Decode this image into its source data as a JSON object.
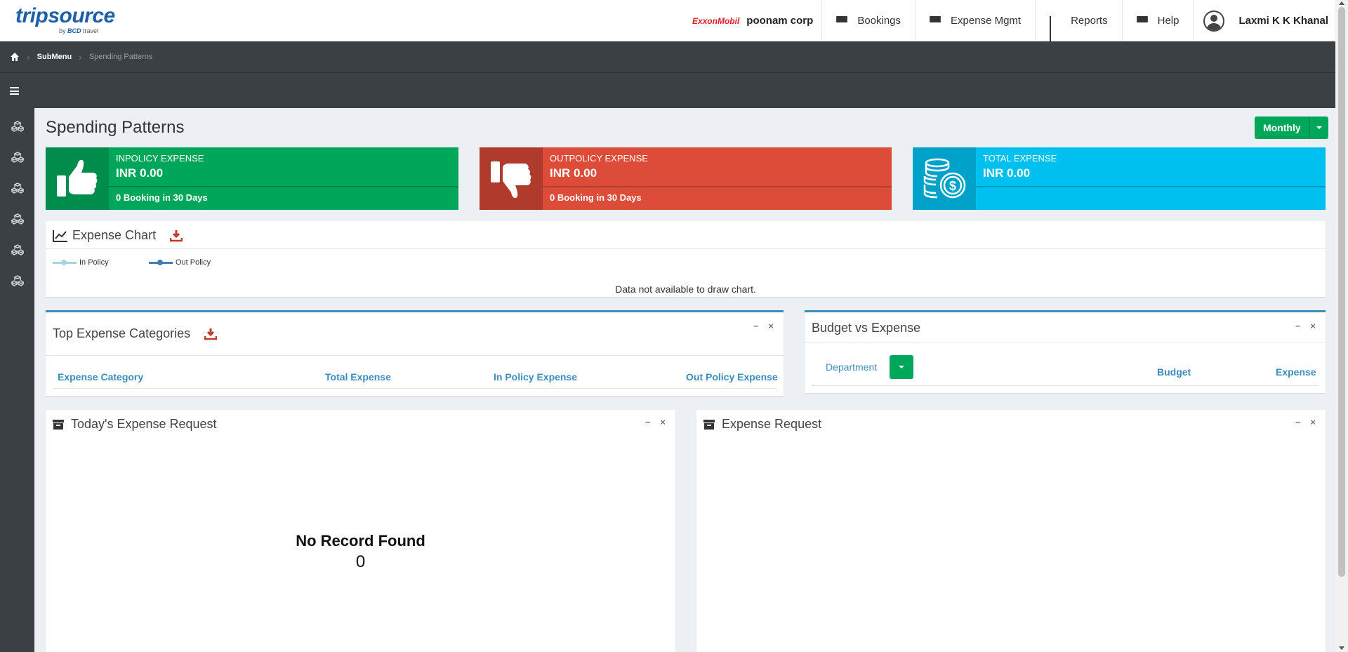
{
  "header": {
    "logo_trip": "trip",
    "logo_source": "source",
    "logo_by": "by",
    "logo_bcd": "BCD",
    "logo_travel": "travel",
    "company_logo": "ExxonMobil",
    "company_name": "poonam corp",
    "nav": [
      {
        "label": "Bookings",
        "icon": "hamburger-icon"
      },
      {
        "label": "Expense Mgmt",
        "icon": "hamburger-icon"
      },
      {
        "label": "Reports",
        "icon": "bar-chart-icon"
      },
      {
        "label": "Help",
        "icon": "hamburger-icon"
      }
    ],
    "user_name": "Laxmi K K Khanal"
  },
  "breadcrumb": {
    "submenu": "SubMenu",
    "current": "Spending Patterns"
  },
  "page": {
    "title": "Spending Patterns",
    "period_button": "Monthly"
  },
  "infoboxes": [
    {
      "title": "INPOLICY EXPENSE",
      "amount": "INR 0.00",
      "footer": "0 Booking in 30 Days",
      "color": "#00a65a",
      "icon_bg": "#008d4c",
      "icon": "thumbs-up-icon"
    },
    {
      "title": "OUTPOLICY EXPENSE",
      "amount": "INR 0.00",
      "footer": "0 Booking in 30 Days",
      "color": "#dd4b39",
      "icon_bg": "#b03a2c",
      "icon": "thumbs-down-icon"
    },
    {
      "title": "TOTAL EXPENSE",
      "amount": "INR 0.00",
      "footer": "",
      "color": "#00c0ef",
      "icon_bg": "#00a2c9",
      "icon": "coins-icon"
    }
  ],
  "expense_chart": {
    "title": "Expense Chart",
    "legend": [
      "In Policy",
      "Out Policy"
    ],
    "legend_colors": [
      "#a6d3e5",
      "#3f7fb1"
    ],
    "empty_message": "Data not available to draw chart."
  },
  "top_categories": {
    "title": "Top Expense Categories",
    "columns": [
      "Expense Category",
      "Total Expense",
      "In Policy Expense",
      "Out Policy Expense"
    ]
  },
  "budget_vs_expense": {
    "title": "Budget vs Expense",
    "department_label": "Department",
    "columns": [
      "Budget",
      "Expense"
    ]
  },
  "todays_request": {
    "title": "Today's Expense Request",
    "empty_title": "No Record Found",
    "count": "0"
  },
  "expense_request": {
    "title": "Expense Request"
  },
  "box_tools": {
    "minimize": "−",
    "close": "×"
  }
}
